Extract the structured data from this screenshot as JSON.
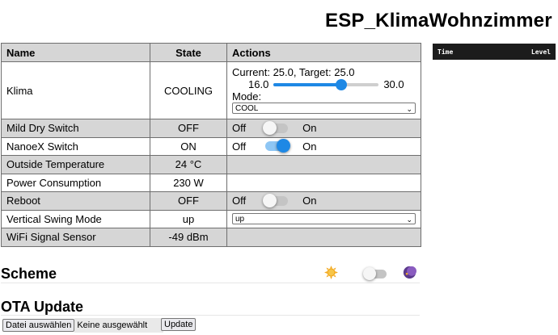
{
  "page_title": "ESP_KlimaWohnzimmer",
  "table": {
    "headers": {
      "name": "Name",
      "state": "State",
      "actions": "Actions"
    },
    "klima": {
      "name": "Klima",
      "state": "COOLING",
      "current_target": "Current: 25.0, Target: 25.0",
      "min": "16.0",
      "max": "30.0",
      "target_fraction": 0.64,
      "mode_label": "Mode:",
      "mode_value": "COOL"
    },
    "rows": [
      {
        "name": "Mild Dry Switch",
        "state": "OFF",
        "off": "Off",
        "on": "On",
        "toggle": false
      },
      {
        "name": "NanoeX Switch",
        "state": "ON",
        "off": "Off",
        "on": "On",
        "toggle": true
      },
      {
        "name": "Outside Temperature",
        "state": "24 °C"
      },
      {
        "name": "Power Consumption",
        "state": "230 W"
      },
      {
        "name": "Reboot",
        "state": "OFF",
        "off": "Off",
        "on": "On",
        "toggle": false
      },
      {
        "name": "Vertical Swing Mode",
        "state": "up",
        "select": "up"
      },
      {
        "name": "WiFi Signal Sensor",
        "state": "-49 dBm"
      }
    ]
  },
  "log": {
    "time": "Time",
    "level": "Level"
  },
  "scheme": {
    "title": "Scheme",
    "dark_mode": false
  },
  "ota": {
    "title": "OTA Update",
    "choose_file": "Datei auswählen",
    "no_file": "Keine ausgewählt",
    "update": "Update"
  }
}
